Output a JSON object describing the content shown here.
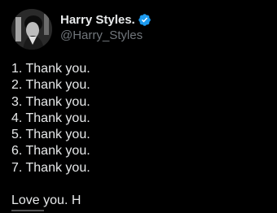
{
  "author": {
    "display_name": "Harry Styles.",
    "handle": "@Harry_Styles",
    "avatar": "profile-photo",
    "verified_icon": "verified-badge-icon",
    "verified_color": "#1d9bf0"
  },
  "tweet": {
    "lines": [
      "1. Thank you.",
      "2. Thank you.",
      "3. Thank you.",
      "4. Thank you.",
      "5. Thank you.",
      "6. Thank you.",
      "7. Thank you."
    ],
    "signoff": "Love you. H"
  },
  "theme": {
    "background": "#000000",
    "text": "#e7e9ea",
    "secondary_text": "#71767b"
  }
}
